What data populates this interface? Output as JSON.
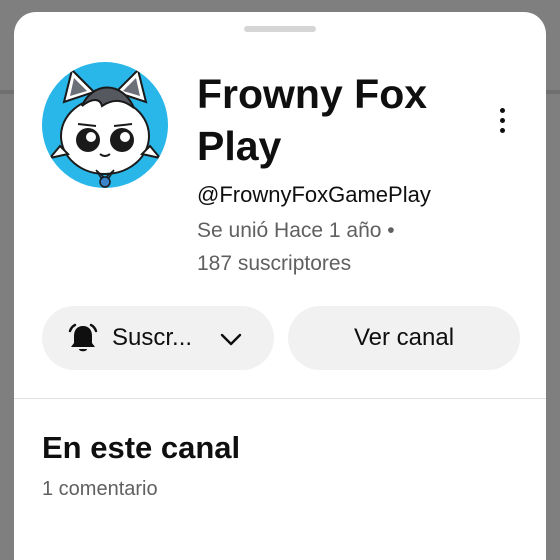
{
  "channel": {
    "name": "Frowny Fox Play",
    "handle": "@FrownyFoxGamePlay",
    "joined": "Se unió Hace 1 año •",
    "subscribers": "187 suscriptores",
    "avatar_bg_color": "#29b6e8"
  },
  "actions": {
    "subscribe_label": "Suscr...",
    "subscribe_icon": "bell-icon",
    "subscribe_dropdown_icon": "chevron-down-icon",
    "view_channel_label": "Ver canal",
    "more_icon": "more-vertical-icon"
  },
  "section": {
    "title": "En este canal",
    "subtitle": "1 comentario"
  }
}
